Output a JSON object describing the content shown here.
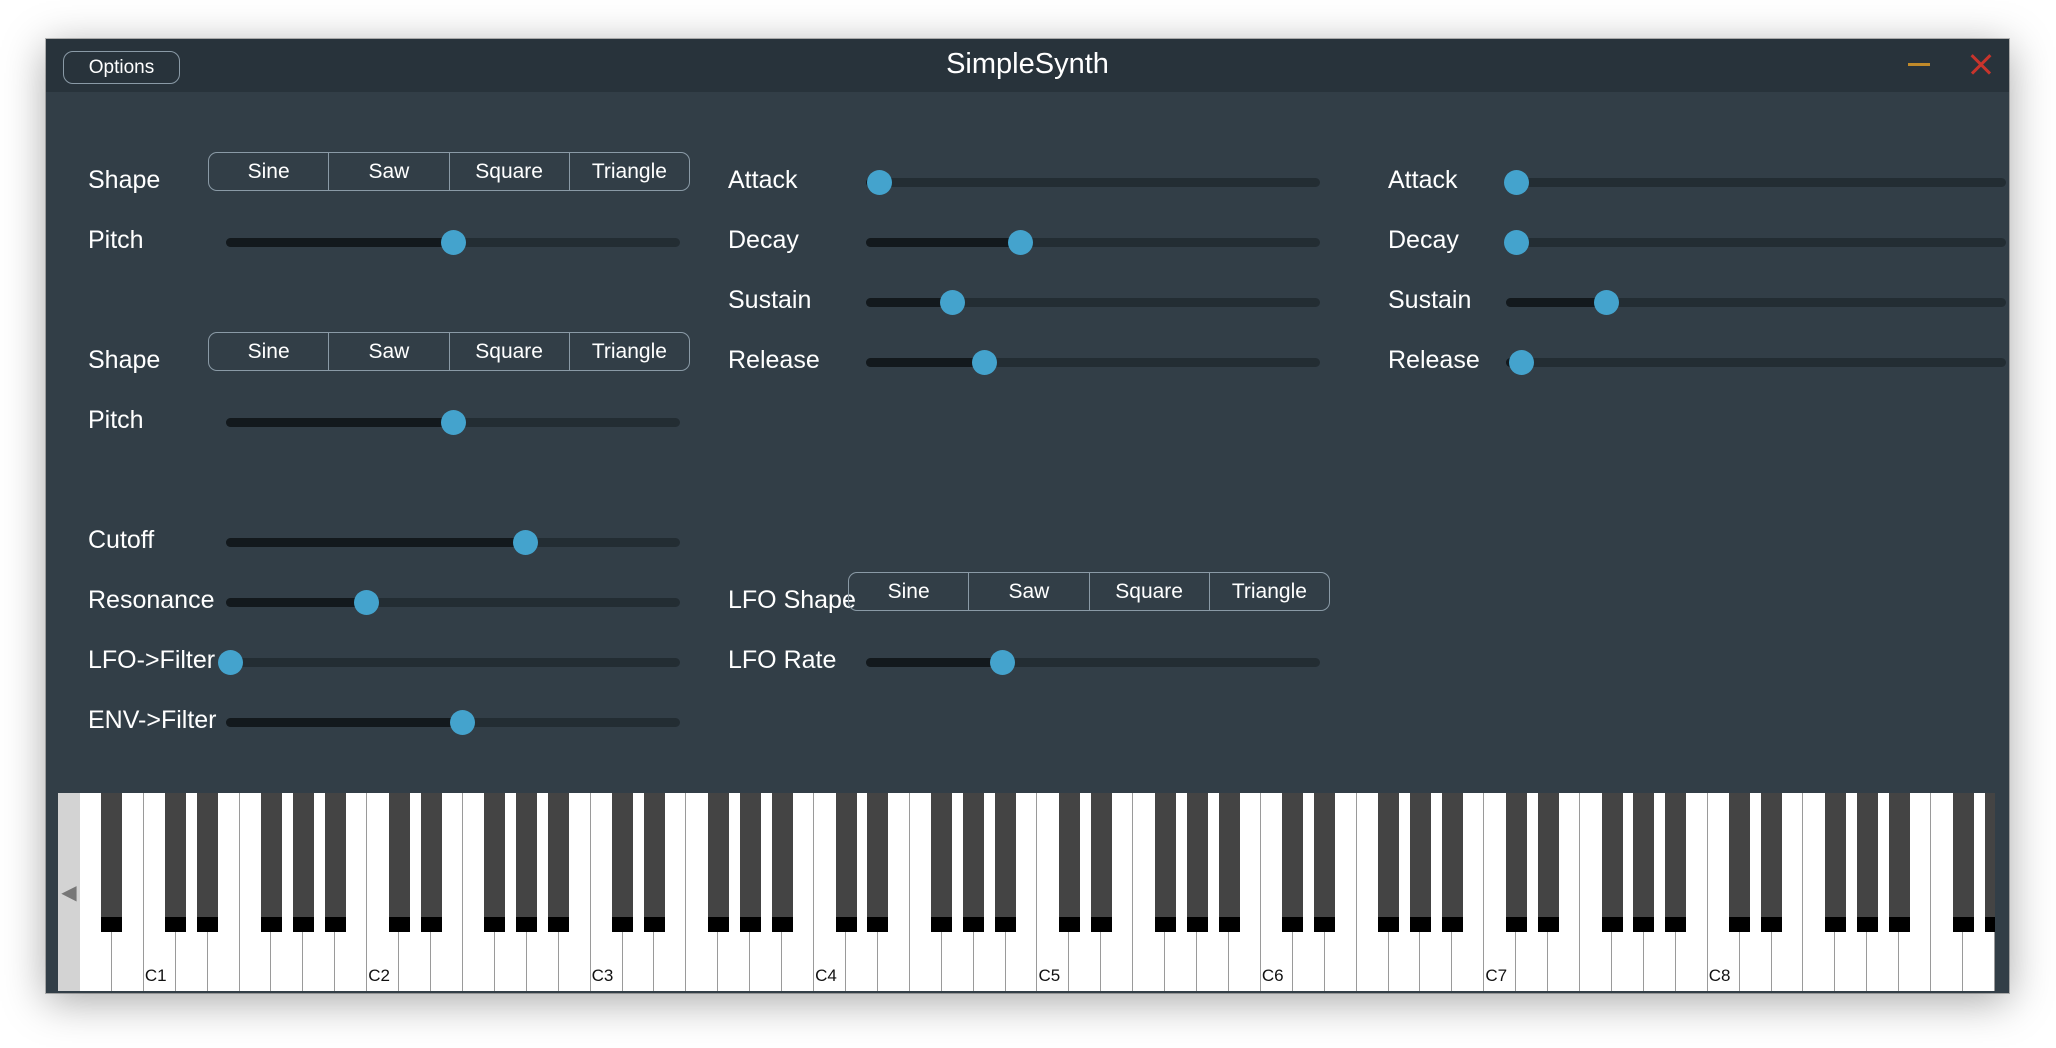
{
  "window": {
    "title": "SimpleSynth",
    "options_label": "Options"
  },
  "oscillators": [
    {
      "shape_label": "Shape",
      "pitch_label": "Pitch",
      "shapes": [
        "Sine",
        "Saw",
        "Square",
        "Triangle"
      ],
      "pitch_value": 0.5
    },
    {
      "shape_label": "Shape",
      "pitch_label": "Pitch",
      "shapes": [
        "Sine",
        "Saw",
        "Square",
        "Triangle"
      ],
      "pitch_value": 0.5
    }
  ],
  "filter": {
    "cutoff_label": "Cutoff",
    "cutoff_value": 0.66,
    "resonance_label": "Resonance",
    "resonance_value": 0.31,
    "lfo_filter_label": "LFO->Filter",
    "lfo_filter_value": 0.01,
    "env_filter_label": "ENV->Filter",
    "env_filter_value": 0.52
  },
  "envelope1": {
    "attack_label": "Attack",
    "attack_value": 0.03,
    "decay_label": "Decay",
    "decay_value": 0.34,
    "sustain_label": "Sustain",
    "sustain_value": 0.19,
    "release_label": "Release",
    "release_value": 0.26
  },
  "envelope2": {
    "attack_label": "Attack",
    "attack_value": 0.02,
    "decay_label": "Decay",
    "decay_value": 0.02,
    "sustain_label": "Sustain",
    "sustain_value": 0.2,
    "release_label": "Release",
    "release_value": 0.03
  },
  "lfo": {
    "shape_label": "LFO Shape",
    "shapes": [
      "Sine",
      "Saw",
      "Square",
      "Triangle"
    ],
    "rate_label": "LFO Rate",
    "rate_value": 0.3
  },
  "keyboard": {
    "scroll_icon": "triangle-left-icon",
    "octave_labels": [
      "C1",
      "C2",
      "C3",
      "C4",
      "C5",
      "C6",
      "C7",
      "C8"
    ]
  },
  "colors": {
    "accent": "#44a3cd",
    "background": "#323e47",
    "minimize": "#c08a2a",
    "close": "#c8342c"
  }
}
